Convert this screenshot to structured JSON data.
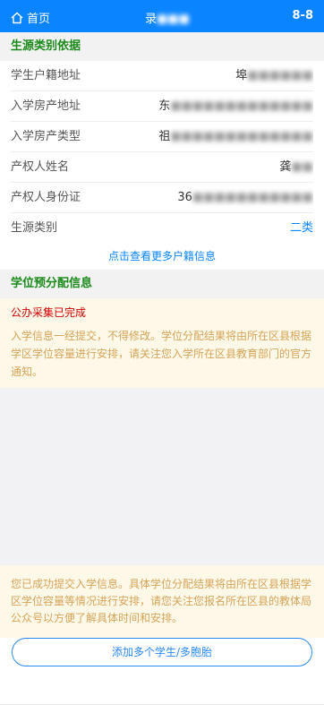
{
  "header": {
    "home_label": "首页",
    "title": "录",
    "right": "8-8",
    "home_icon": "home-icon"
  },
  "source_section": {
    "title": "生源类别依据",
    "rows": [
      {
        "label": "学生户籍地址",
        "value": "埠"
      },
      {
        "label": "入学房产地址",
        "value": "东"
      },
      {
        "label": "入学房产类型",
        "value": "祖"
      },
      {
        "label": "产权人姓名",
        "value": "龚"
      },
      {
        "label": "产权人身份证",
        "value": "36"
      },
      {
        "label": "生源类别",
        "value": "二类"
      }
    ],
    "more_link": "点击查看更多户籍信息"
  },
  "allocation_section": {
    "title": "学位预分配信息",
    "status": "公办采集已完成",
    "notice": "入学信息一经提交，不得修改。学位分配结果将由所在区县根据学区学位容量进行安排，请关注您入学所在区县教育部门的官方通知。"
  },
  "bottom_notice": "您已成功提交入学信息。具体学位分配结果将由所在区县根据学区学位容量等情况进行安排，请您关注您报名所在区县的教体局公众号以方便了解具体时间和安排。",
  "add_button": "添加多个学生/多胞胎",
  "colors": {
    "primary": "#0a84ff",
    "section_green": "#1b8a1b",
    "warning_text": "#d6a45a",
    "status_red": "#d40000"
  }
}
